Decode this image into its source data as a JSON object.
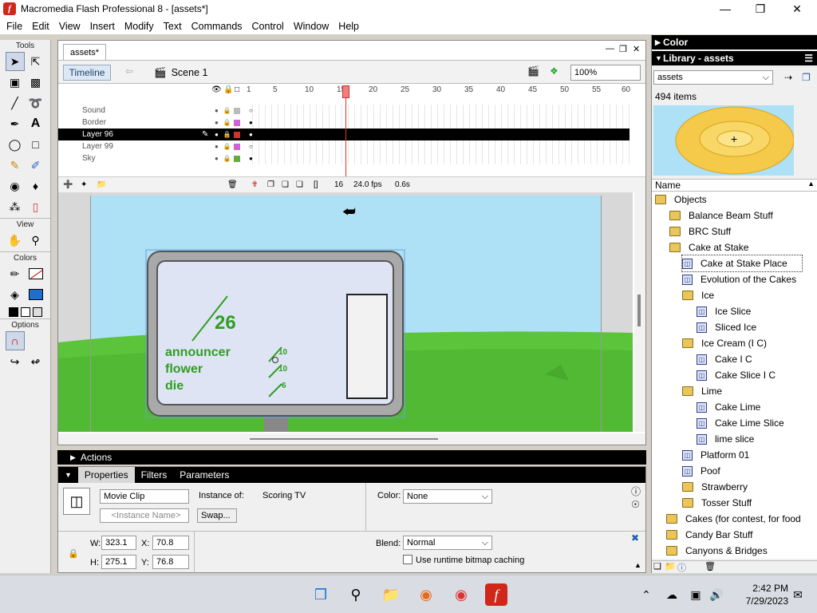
{
  "window": {
    "title": "Macromedia Flash Professional 8 - [assets*]",
    "app_icon": "f"
  },
  "menu": [
    "File",
    "Edit",
    "View",
    "Insert",
    "Modify",
    "Text",
    "Commands",
    "Control",
    "Window",
    "Help"
  ],
  "tools": {
    "title": "Tools",
    "view_label": "View",
    "colors_label": "Colors",
    "options_label": "Options"
  },
  "document": {
    "tab": "assets*",
    "timeline_button": "Timeline",
    "scene": "Scene 1",
    "zoom": "100%",
    "ruler_ticks": [
      "1",
      "5",
      "10",
      "15",
      "20",
      "25",
      "30",
      "35",
      "40",
      "45",
      "50",
      "55",
      "60"
    ],
    "layers": [
      {
        "name": "Sound",
        "color": "#bbbbbb"
      },
      {
        "name": "Border",
        "color": "#cc66cc"
      },
      {
        "name": "Layer 96",
        "color": "#cc3333"
      },
      {
        "name": "Layer 99",
        "color": "#cc66cc"
      },
      {
        "name": "Sky",
        "color": "#66aa44"
      }
    ],
    "current_frame": "16",
    "fps": "24.0 fps",
    "elapsed": "0.6s"
  },
  "stage": {
    "score": "26",
    "labels": [
      "announcer",
      "flower",
      "die"
    ],
    "small_numbers": [
      "10",
      "10",
      "6"
    ]
  },
  "actions_label": "Actions",
  "properties": {
    "tabs": [
      "Properties",
      "Filters",
      "Parameters"
    ],
    "symbol_type": "Movie Clip",
    "instance_name_placeholder": "<Instance Name>",
    "instance_of_label": "Instance of:",
    "instance_of": "Scoring TV",
    "swap_button": "Swap...",
    "color_label": "Color:",
    "color_value": "None",
    "w_label": "W:",
    "w": "323.1",
    "h_label": "H:",
    "h": "275.1",
    "x_label": "X:",
    "x": "70.8",
    "y_label": "Y:",
    "y": "76.8",
    "blend_label": "Blend:",
    "blend_value": "Normal",
    "cache_label": "Use runtime bitmap caching"
  },
  "color_panel": {
    "title": "Color"
  },
  "library": {
    "title": "Library - assets",
    "doc": "assets",
    "count": "494 items",
    "name_header": "Name",
    "items": [
      {
        "label": "Objects",
        "type": "folder",
        "level": 0
      },
      {
        "label": "Balance Beam Stuff",
        "type": "folder",
        "level": 1
      },
      {
        "label": "BRC Stuff",
        "type": "folder",
        "level": 1
      },
      {
        "label": "Cake at Stake",
        "type": "folder",
        "level": 1
      },
      {
        "label": "Cake at Stake Place",
        "type": "symbol",
        "level": 2
      },
      {
        "label": "Evolution of the Cakes",
        "type": "symbol",
        "level": 2
      },
      {
        "label": "Ice",
        "type": "folder",
        "level": 2
      },
      {
        "label": "Ice Slice",
        "type": "symbol",
        "level": 3
      },
      {
        "label": "Sliced Ice",
        "type": "symbol",
        "level": 3
      },
      {
        "label": "Ice Cream (I C)",
        "type": "folder",
        "level": 2
      },
      {
        "label": "Cake I C",
        "type": "symbol",
        "level": 3
      },
      {
        "label": "Cake Slice I C",
        "type": "symbol",
        "level": 3
      },
      {
        "label": "Lime",
        "type": "folder",
        "level": 2
      },
      {
        "label": "Cake Lime",
        "type": "symbol",
        "level": 3
      },
      {
        "label": "Cake Lime Slice",
        "type": "symbol",
        "level": 3
      },
      {
        "label": "lime slice",
        "type": "symbol",
        "level": 3
      },
      {
        "label": "Platform 01",
        "type": "symbol",
        "level": 2
      },
      {
        "label": "Poof",
        "type": "symbol",
        "level": 2
      },
      {
        "label": "Strawberry",
        "type": "folder",
        "level": 2
      },
      {
        "label": "Tosser Stuff",
        "type": "folder",
        "level": 2
      },
      {
        "label": "Cakes (for contest, for food",
        "type": "folder",
        "level": 1
      },
      {
        "label": "Candy Bar Stuff",
        "type": "folder",
        "level": 1
      },
      {
        "label": "Canyons & Bridges",
        "type": "folder",
        "level": 1
      }
    ]
  },
  "taskbar": {
    "time": "2:42 PM",
    "date": "7/29/2023"
  },
  "colors": {
    "stage_sky": "#aee0f6",
    "grass": "#5cc43a",
    "score_green": "#2f9e22",
    "tv_frame": "#a9a9a9",
    "panel_black": "#000000"
  }
}
